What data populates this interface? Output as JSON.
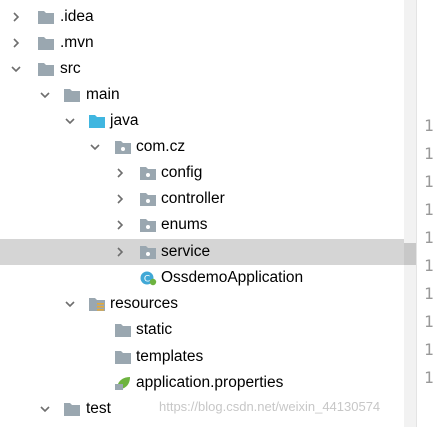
{
  "tree": {
    "items": [
      {
        "label": ".idea",
        "icon": "folder-icon",
        "expanded": false
      },
      {
        "label": ".mvn",
        "icon": "folder-icon",
        "expanded": false
      },
      {
        "label": "src",
        "icon": "folder-icon",
        "expanded": true
      },
      {
        "label": "main",
        "icon": "folder-icon",
        "expanded": true
      },
      {
        "label": "java",
        "icon": "source-folder-icon",
        "expanded": true
      },
      {
        "label": "com.cz",
        "icon": "package-icon",
        "expanded": true
      },
      {
        "label": "config",
        "icon": "package-icon",
        "expanded": false
      },
      {
        "label": "controller",
        "icon": "package-icon",
        "expanded": false
      },
      {
        "label": "enums",
        "icon": "package-icon",
        "expanded": false
      },
      {
        "label": "service",
        "icon": "package-icon",
        "expanded": false,
        "selected": true
      },
      {
        "label": "OssdemoApplication",
        "icon": "spring-boot-class-icon"
      },
      {
        "label": "resources",
        "icon": "resources-folder-icon",
        "expanded": true
      },
      {
        "label": "static",
        "icon": "folder-icon"
      },
      {
        "label": "templates",
        "icon": "folder-icon"
      },
      {
        "label": "application.properties",
        "icon": "spring-properties-icon"
      },
      {
        "label": "test",
        "icon": "folder-icon",
        "expanded": true
      }
    ]
  },
  "editor": {
    "line_numbers": [
      "1",
      "1",
      "1",
      "1",
      "1",
      "1",
      "1",
      "1",
      "1",
      "1"
    ]
  },
  "watermark": "https://blog.csdn.net/weixin_44130574",
  "colors": {
    "selection": "#d5d5d5",
    "folder": "#9aa7b0",
    "source_folder": "#40b6e0",
    "spring_green": "#6db33f"
  }
}
